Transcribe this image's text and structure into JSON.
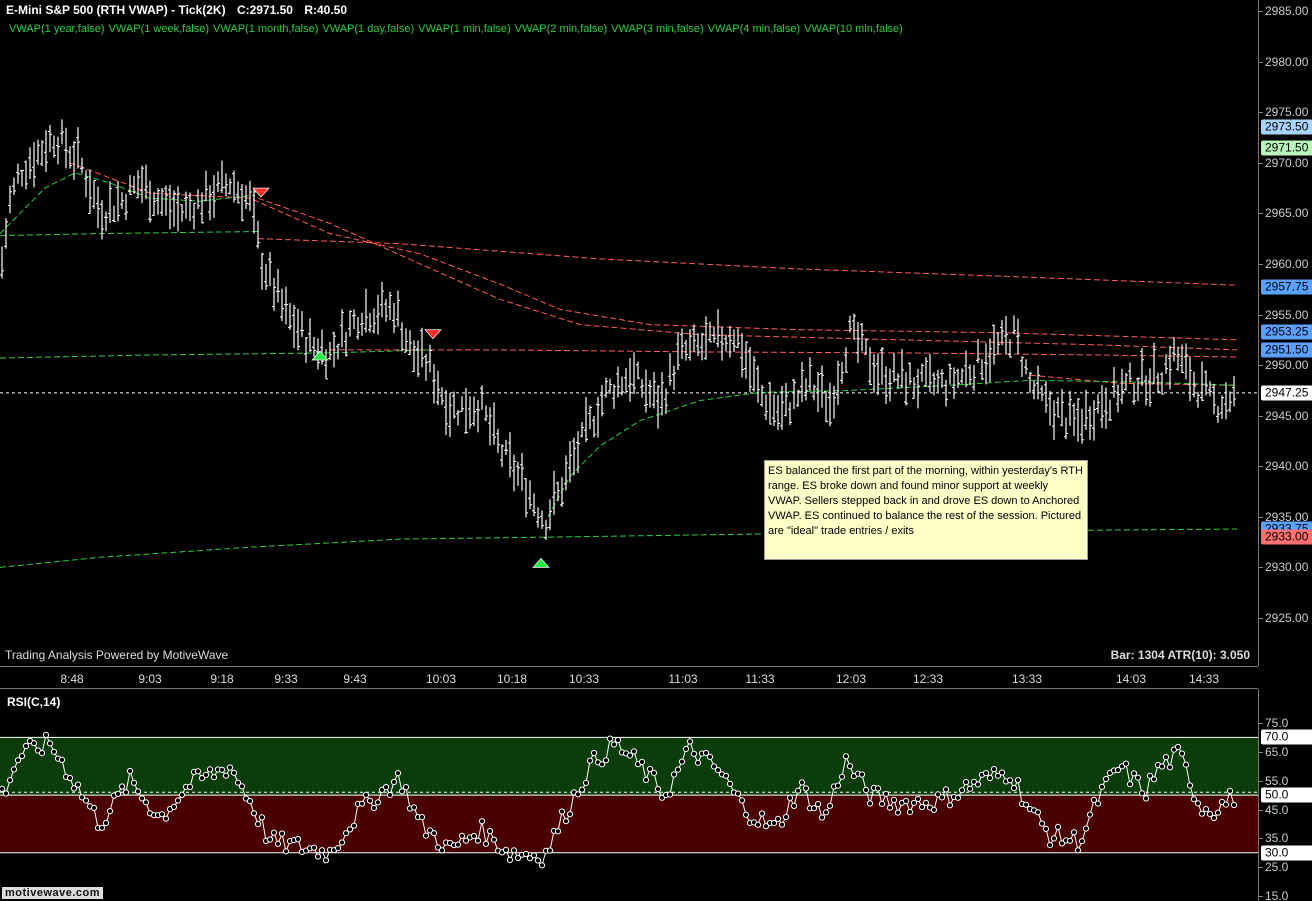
{
  "header": {
    "symbol": "E-Mini S&P 500 (RTH VWAP) - Tick(2K)",
    "close": "C:2971.50",
    "range": "R:40.50"
  },
  "vwap_legend": [
    "VWAP(1 year,false)",
    "VWAP(1 week,false)",
    "VWAP(1 month,false)",
    "VWAP(1 day,false)",
    "VWAP(1 min,false)",
    "VWAP(2 min,false)",
    "VWAP(3 min,false)",
    "VWAP(4 min,false)",
    "VWAP(10 min,false)"
  ],
  "watermark": "Trading Analysis Powered by MotiveWave",
  "bar_info": "Bar: 1304  ATR(10): 3.050",
  "annotation": "ES balanced the first part of the morning, within yesterday's RTH range.  ES broke down and found minor support at weekly VWAP.  Sellers stepped back in and drove ES down to Anchored VWAP.  ES continued to balance the rest of the session.    Pictured are \"ideal\" trade entries / exits",
  "price_axis": {
    "ticks": [
      "2985.00",
      "2980.00",
      "2975.00",
      "2970.00",
      "2965.00",
      "2960.00",
      "2955.00",
      "2950.00",
      "2945.00",
      "2940.00",
      "2935.00",
      "2930.00",
      "2925.00"
    ],
    "tags": [
      {
        "label": "2973.50",
        "color": "#a8d4ff"
      },
      {
        "label": "2971.50",
        "color": "#b8f5b8"
      },
      {
        "label": "2957.75",
        "color": "#5aa0ff"
      },
      {
        "label": "2953.25",
        "color": "#5aa0ff"
      },
      {
        "label": "2951.50",
        "color": "#5aa0ff"
      },
      {
        "label": "2947.25",
        "color": "#ffffff"
      },
      {
        "label": "2933.75",
        "color": "#5aa0ff"
      },
      {
        "label": "2933.00",
        "color": "#ff7070"
      }
    ]
  },
  "time_axis": [
    "8:48",
    "9:03",
    "9:18",
    "9:33",
    "9:43",
    "10:03",
    "10:18",
    "10:33",
    "11:03",
    "11:33",
    "12:03",
    "12:33",
    "13:33",
    "14:03",
    "14:33"
  ],
  "rsi": {
    "title": "RSI(C,14)",
    "ticks": [
      "75.0",
      "65.0",
      "55.0",
      "45.0",
      "35.0",
      "25.0",
      "15.0"
    ],
    "tags": [
      {
        "label": "70.0",
        "color": "#ffffff"
      },
      {
        "label": "50.0",
        "color": "#ffffff"
      },
      {
        "label": "30.0",
        "color": "#ffffff"
      }
    ]
  },
  "logo": "motivewave.com",
  "colors": {
    "vwap_green": "#2ecc40",
    "vwap_red": "#ff5a5a",
    "overbought_zone": "#0a3d0a",
    "oversold_zone": "#4a0000"
  },
  "signals": [
    {
      "type": "sell",
      "price": 2967.0
    },
    {
      "type": "buy",
      "price": 2951.0
    },
    {
      "type": "sell",
      "price": 2953.0
    },
    {
      "type": "buy",
      "price": 2930.5
    }
  ]
}
